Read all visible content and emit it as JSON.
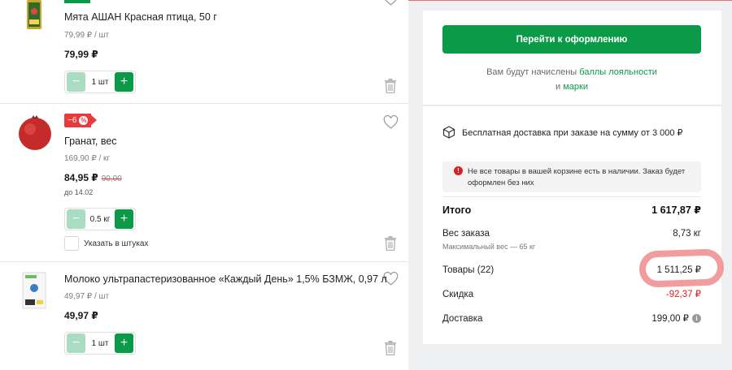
{
  "products": [
    {
      "name": "Мята АШАН Красная птица, 50 г",
      "unit_price": "79,99 ₽ / шт",
      "price": "79,99 ₽",
      "quantity": "1 шт"
    },
    {
      "badge": "−6",
      "badge_pct": "%",
      "name": "Гранат, вес",
      "unit_price": "169,90 ₽ / кг",
      "price": "84,95 ₽",
      "old_price": "90,00",
      "valid_until": "до 14.02",
      "quantity": "0.5 кг",
      "checkbox_label": "Указать в штуках"
    },
    {
      "name": "Молоко ультрапастеризованное «Каждый День» 1,5% БЗМЖ, 0,97 л",
      "unit_price": "49,97 ₽ / шт",
      "price": "49,97 ₽",
      "quantity": "1 шт"
    }
  ],
  "stepper": {
    "minus": "−",
    "plus": "+"
  },
  "summary": {
    "checkout_button": "Перейти к оформлению",
    "loyalty_prefix": "Вам будут начислены",
    "loyalty_link1": "баллы лояльности",
    "loyalty_and": "и",
    "loyalty_link2": "марки",
    "delivery_note": "Бесплатная доставка при заказе на сумму от 3 000 ₽",
    "alert_icon": "!",
    "alert_text": "Не все товары в вашей корзине есть в наличии. Заказ будет оформлен без них",
    "total_label": "Итого",
    "total_value": "1 617,87 ₽",
    "weight_label": "Вес заказа",
    "weight_value": "8,73 кг",
    "max_weight": "Максимальный вес — 65 кг",
    "goods_label": "Товары (22)",
    "goods_value": "1 511,25 ₽",
    "discount_label": "Скидка",
    "discount_value": "-92,37 ₽",
    "shipping_label": "Доставка",
    "shipping_value": "199,00 ₽",
    "info_icon": "i"
  },
  "colors": {
    "accent_green": "#0b9a48",
    "light_green": "#a9dcc0",
    "discount_red": "#e01e1e",
    "badge_red": "#e8393d",
    "highlight": "#ee8c8c"
  }
}
